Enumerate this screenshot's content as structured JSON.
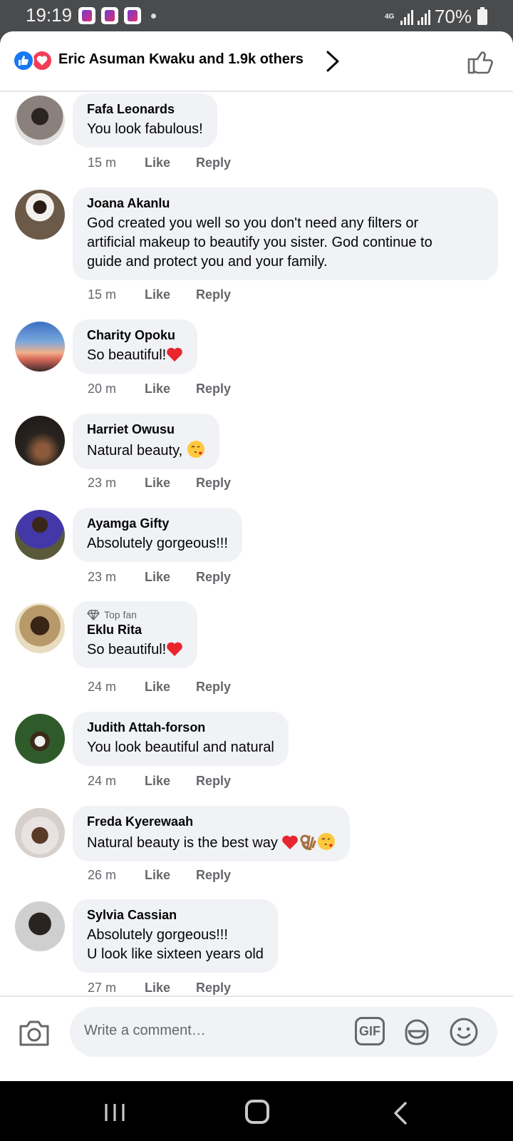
{
  "status_bar": {
    "time": "19:19",
    "network": "4G",
    "battery": "70%"
  },
  "header": {
    "reactions_text": "Eric Asuman Kwaku and 1.9k others",
    "reaction_icons": [
      "like-icon",
      "love-icon"
    ]
  },
  "comments": [
    {
      "name": "Fafa Leonards",
      "lines": [
        "You look fabulous!"
      ],
      "time": "15 m",
      "like": "Like",
      "reply": "Reply",
      "avatar_color": "#6b6461"
    },
    {
      "name": "Joana Akanlu",
      "lines": [
        "God created you well so you don't need any filters or",
        "artificial makeup to beautify you sister. God continue to",
        "guide and protect you and your family."
      ],
      "time": "15 m",
      "like": "Like",
      "reply": "Reply",
      "avatar_color": "#4b3b2f"
    },
    {
      "name": "Charity Opoku",
      "lines": [
        "So beautiful!"
      ],
      "emoji": "heart",
      "time": "20 m",
      "like": "Like",
      "reply": "Reply",
      "avatar_color": "#3d78c8"
    },
    {
      "name": "Harriet Owusu",
      "lines": [
        "Natural beauty,"
      ],
      "emoji": "kiss",
      "time": "23 m",
      "like": "Like",
      "reply": "Reply",
      "avatar_color": "#2a2622"
    },
    {
      "name": "Ayamga Gifty",
      "lines": [
        "Absolutely gorgeous!!!"
      ],
      "time": "23 m",
      "like": "Like",
      "reply": "Reply",
      "avatar_color": "#5a4a2a"
    },
    {
      "badge": "Top fan",
      "name": "Eklu Rita",
      "lines": [
        "So beautiful!"
      ],
      "emoji": "heart",
      "time": "24 m",
      "like": "Like",
      "reply": "Reply",
      "avatar_color": "#7a6a4a"
    },
    {
      "name": "Judith Attah-forson",
      "lines": [
        "You look beautiful and natural"
      ],
      "time": "24 m",
      "like": "Like",
      "reply": "Reply",
      "avatar_color": "#2f5a2a"
    },
    {
      "name": "Freda Kyerewaah",
      "lines": [
        "Natural beauty is the best way"
      ],
      "emoji": "heart-ok-kiss",
      "time": "26 m",
      "like": "Like",
      "reply": "Reply",
      "avatar_color": "#d8d2cf"
    },
    {
      "name": "Sylvia Cassian",
      "lines": [
        "Absolutely gorgeous!!!",
        "U look like sixteen years old"
      ],
      "time": "27 m",
      "like": "Like",
      "reply": "Reply",
      "avatar_color": "#cfcfcf"
    }
  ],
  "composer": {
    "placeholder": "Write a comment…",
    "gif_label": "GIF"
  },
  "colors": {
    "bubble": "#f0f2f5",
    "meta": "#65676b",
    "like_blue": "#1877f2",
    "love_red": "#f33e58"
  }
}
